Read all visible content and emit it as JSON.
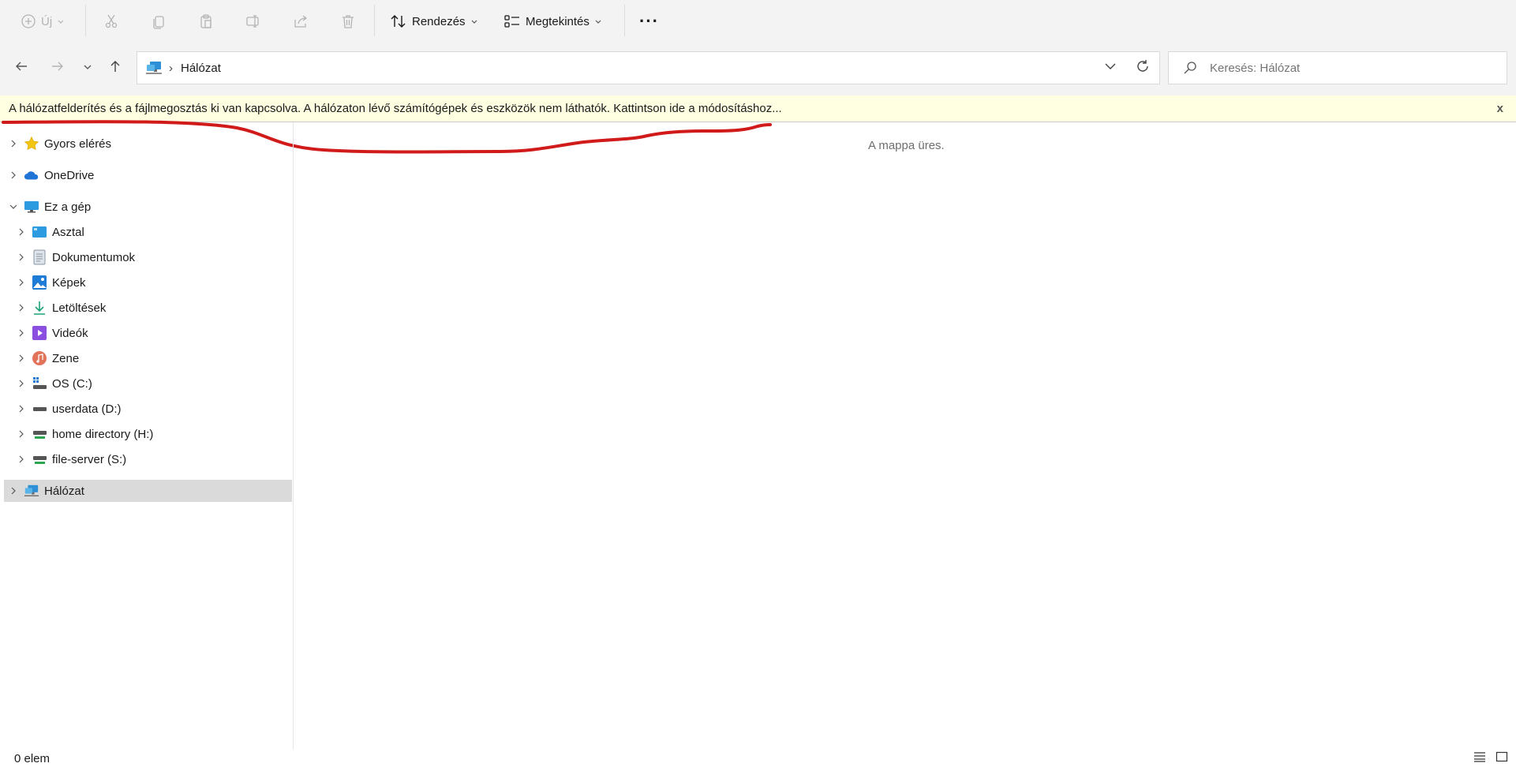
{
  "toolbar": {
    "new_label": "Új",
    "sort_label": "Rendezés",
    "view_label": "Megtekintés",
    "more_label": "···",
    "icons": [
      "plus-circle-icon",
      "scissors-icon",
      "copy-icon",
      "paste-icon",
      "rename-icon",
      "share-icon",
      "trash-icon",
      "sort-icon",
      "view-icon",
      "more-icon"
    ]
  },
  "nav": {
    "back_icon": "arrow-left-icon",
    "forward_icon": "arrow-right-icon",
    "recent_icon": "chevron-down-icon",
    "up_icon": "arrow-up-icon"
  },
  "address": {
    "separator": "›",
    "location": "Hálózat"
  },
  "search": {
    "placeholder": "Keresés: Hálózat"
  },
  "infobar": {
    "message": "A hálózatfelderítés és a fájlmegosztás ki van kapcsolva. A hálózaton lévő számítógépek és eszközök nem láthatók. Kattintson ide a módosításhoz...",
    "close_label": "x"
  },
  "sidebar": {
    "items": [
      {
        "label": "Gyors elérés",
        "icon": "star-icon"
      },
      {
        "label": "OneDrive",
        "icon": "cloud-icon"
      },
      {
        "label": "Ez a gép",
        "icon": "monitor-icon"
      },
      {
        "label": "Asztal",
        "icon": "desktop-icon"
      },
      {
        "label": "Dokumentumok",
        "icon": "documents-icon"
      },
      {
        "label": "Képek",
        "icon": "pictures-icon"
      },
      {
        "label": "Letöltések",
        "icon": "download-icon"
      },
      {
        "label": "Videók",
        "icon": "video-icon"
      },
      {
        "label": "Zene",
        "icon": "music-icon"
      },
      {
        "label": "OS (C:)",
        "icon": "os-drive-icon"
      },
      {
        "label": "userdata (D:)",
        "icon": "drive-icon"
      },
      {
        "label": "home directory (H:)",
        "icon": "network-drive-icon"
      },
      {
        "label": "file-server (S:)",
        "icon": "network-drive-icon"
      },
      {
        "label": "Hálózat",
        "icon": "network-icon"
      }
    ]
  },
  "main": {
    "empty_text": "A mappa üres."
  },
  "status": {
    "count": "0 elem"
  },
  "colors": {
    "infobar_bg": "#ffffe1",
    "selection": "#dadada",
    "annotation": "#d11a1a"
  }
}
